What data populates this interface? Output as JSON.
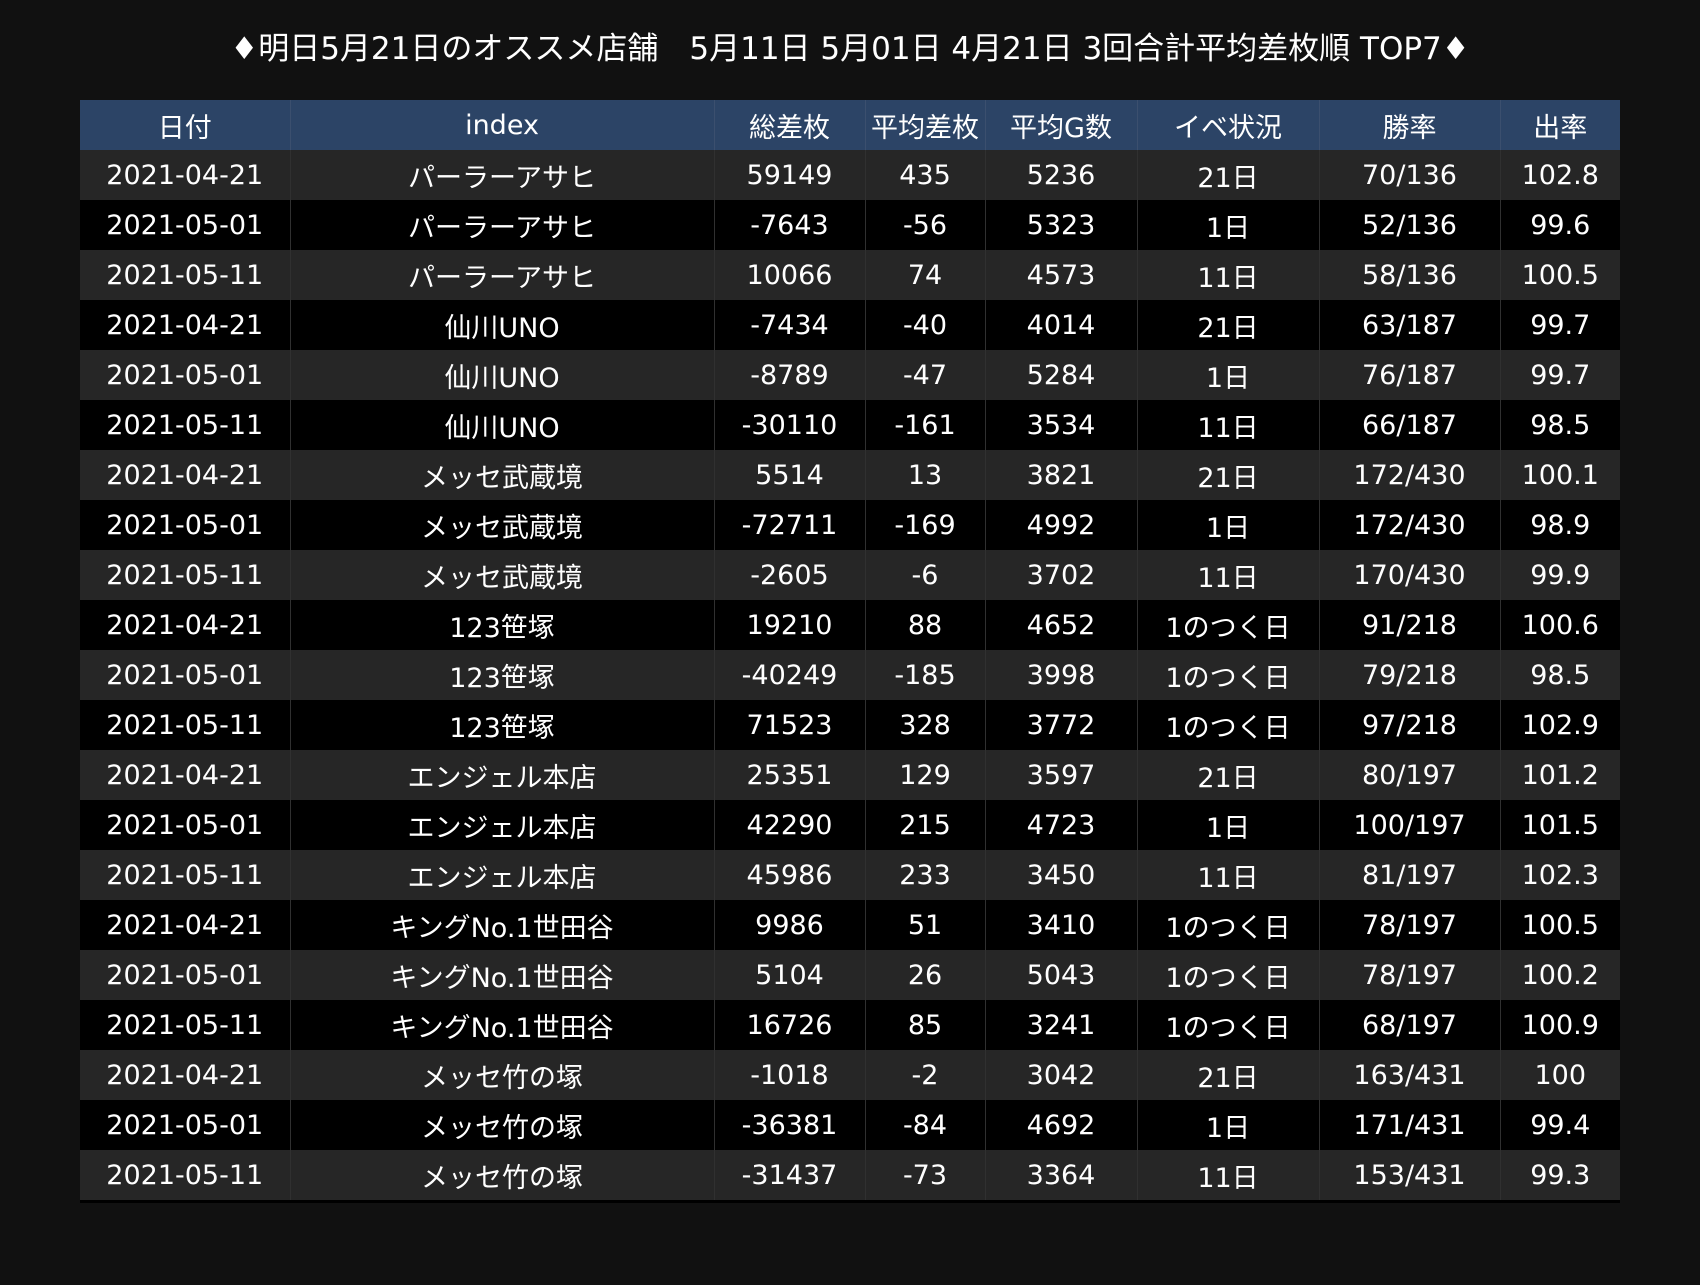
{
  "page": {
    "title": "♦明日5月21日のオススメ店舗　5月11日 5月01日 4月21日  3回合計平均差枚順 TOP7♦"
  },
  "table": {
    "columns": [
      "日付",
      "index",
      "総差枚",
      "平均差枚",
      "平均G数",
      "イベ状況",
      "勝率",
      "出率"
    ],
    "rows": [
      [
        "2021-04-21",
        "パーラーアサヒ",
        "59149",
        "435",
        "5236",
        "21日",
        "70/136",
        "102.8"
      ],
      [
        "2021-05-01",
        "パーラーアサヒ",
        "-7643",
        "-56",
        "5323",
        "1日",
        "52/136",
        "99.6"
      ],
      [
        "2021-05-11",
        "パーラーアサヒ",
        "10066",
        "74",
        "4573",
        "11日",
        "58/136",
        "100.5"
      ],
      [
        "2021-04-21",
        "仙川UNO",
        "-7434",
        "-40",
        "4014",
        "21日",
        "63/187",
        "99.7"
      ],
      [
        "2021-05-01",
        "仙川UNO",
        "-8789",
        "-47",
        "5284",
        "1日",
        "76/187",
        "99.7"
      ],
      [
        "2021-05-11",
        "仙川UNO",
        "-30110",
        "-161",
        "3534",
        "11日",
        "66/187",
        "98.5"
      ],
      [
        "2021-04-21",
        "メッセ武蔵境",
        "5514",
        "13",
        "3821",
        "21日",
        "172/430",
        "100.1"
      ],
      [
        "2021-05-01",
        "メッセ武蔵境",
        "-72711",
        "-169",
        "4992",
        "1日",
        "172/430",
        "98.9"
      ],
      [
        "2021-05-11",
        "メッセ武蔵境",
        "-2605",
        "-6",
        "3702",
        "11日",
        "170/430",
        "99.9"
      ],
      [
        "2021-04-21",
        "123笹塚",
        "19210",
        "88",
        "4652",
        "1のつく日",
        "91/218",
        "100.6"
      ],
      [
        "2021-05-01",
        "123笹塚",
        "-40249",
        "-185",
        "3998",
        "1のつく日",
        "79/218",
        "98.5"
      ],
      [
        "2021-05-11",
        "123笹塚",
        "71523",
        "328",
        "3772",
        "1のつく日",
        "97/218",
        "102.9"
      ],
      [
        "2021-04-21",
        "エンジェル本店",
        "25351",
        "129",
        "3597",
        "21日",
        "80/197",
        "101.2"
      ],
      [
        "2021-05-01",
        "エンジェル本店",
        "42290",
        "215",
        "4723",
        "1日",
        "100/197",
        "101.5"
      ],
      [
        "2021-05-11",
        "エンジェル本店",
        "45986",
        "233",
        "3450",
        "11日",
        "81/197",
        "102.3"
      ],
      [
        "2021-04-21",
        "キングNo.1世田谷",
        "9986",
        "51",
        "3410",
        "1のつく日",
        "78/197",
        "100.5"
      ],
      [
        "2021-05-01",
        "キングNo.1世田谷",
        "5104",
        "26",
        "5043",
        "1のつく日",
        "78/197",
        "100.2"
      ],
      [
        "2021-05-11",
        "キングNo.1世田谷",
        "16726",
        "85",
        "3241",
        "1のつく日",
        "68/197",
        "100.9"
      ],
      [
        "2021-04-21",
        "メッセ竹の塚",
        "-1018",
        "-2",
        "3042",
        "21日",
        "163/431",
        "100"
      ],
      [
        "2021-05-01",
        "メッセ竹の塚",
        "-36381",
        "-84",
        "4692",
        "1日",
        "171/431",
        "99.4"
      ],
      [
        "2021-05-11",
        "メッセ竹の塚",
        "-31437",
        "-73",
        "3364",
        "11日",
        "153/431",
        "99.3"
      ]
    ]
  },
  "colors": {
    "page_background": "#111111",
    "header_background": "#2c4466",
    "row_light": "#262626",
    "row_dark": "#000000",
    "text": "#ffffff"
  }
}
